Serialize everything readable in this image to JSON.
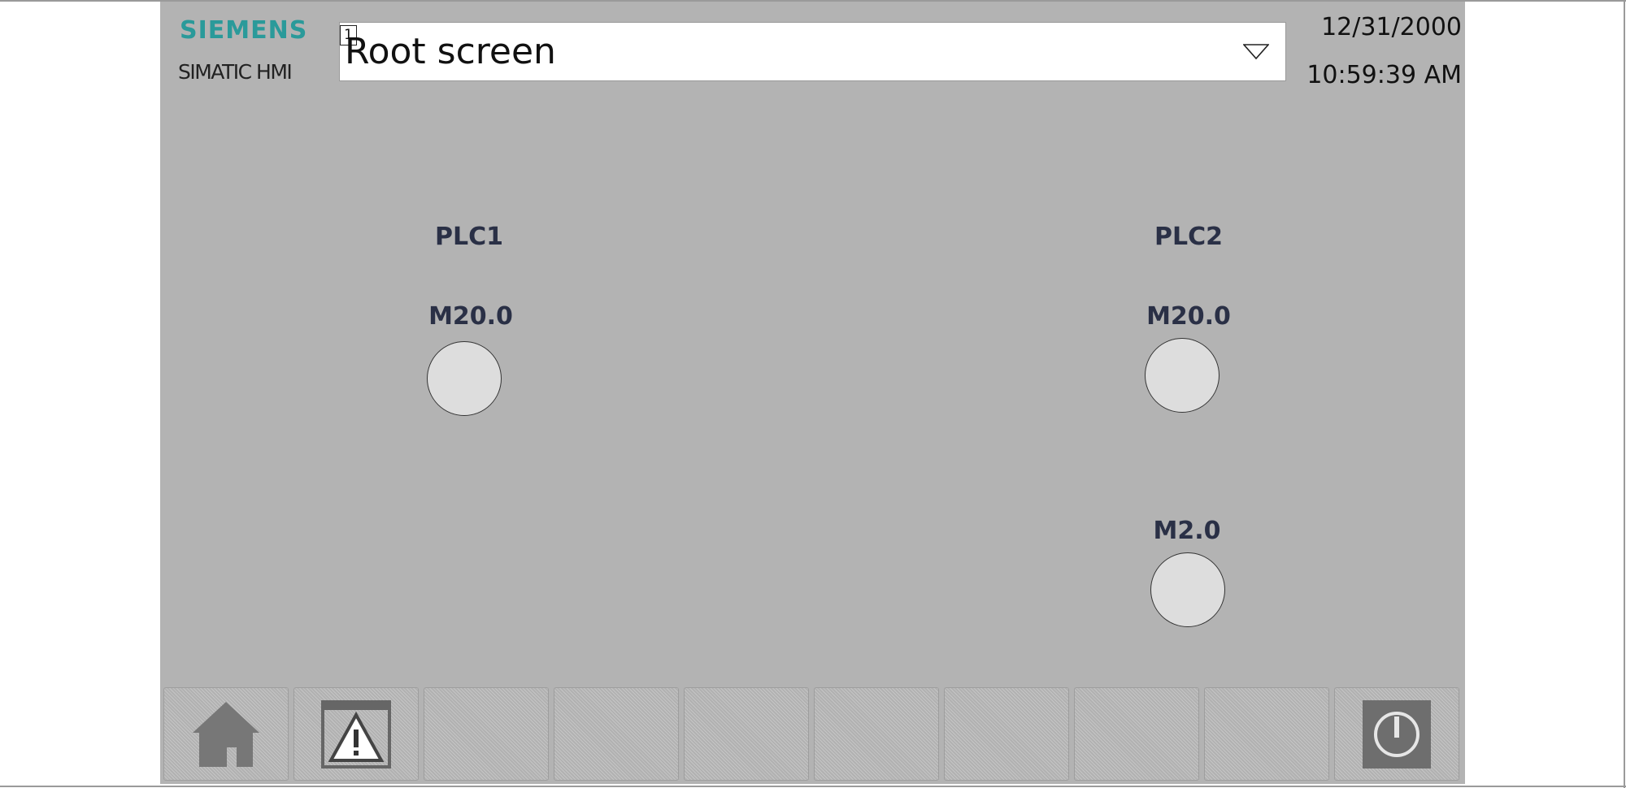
{
  "header": {
    "brand": "SIEMENS",
    "product": "SIMATIC HMI",
    "screen_number": "1",
    "screen_name": "Root screen",
    "date": "12/31/2000",
    "time": "10:59:39 AM"
  },
  "main": {
    "plc1": {
      "title": "PLC1",
      "tag": "M20.0"
    },
    "plc2": {
      "title": "PLC2",
      "tag1": "M20.0",
      "tag2": "M2.0"
    }
  },
  "toolbar": {
    "buttons": [
      {
        "icon": "home-icon"
      },
      {
        "icon": "alarm-warning-icon"
      },
      {
        "icon": ""
      },
      {
        "icon": ""
      },
      {
        "icon": ""
      },
      {
        "icon": ""
      },
      {
        "icon": ""
      },
      {
        "icon": ""
      },
      {
        "icon": ""
      },
      {
        "icon": "power-icon"
      }
    ]
  },
  "colors": {
    "panel_background": "#b3b3b3",
    "brand_color": "#2a9a9a",
    "lamp_off": "#dddddd",
    "label_color": "#2a3046"
  }
}
